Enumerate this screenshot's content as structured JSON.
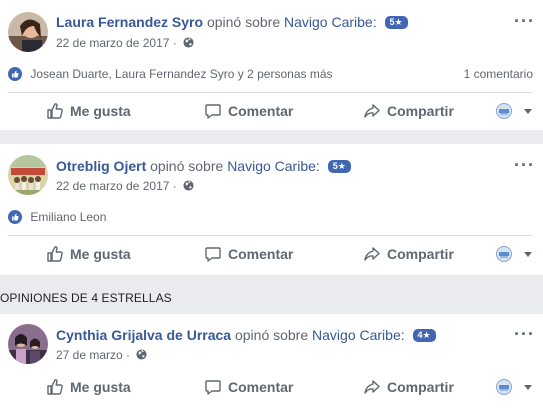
{
  "posts": [
    {
      "author": "Laura Fernandez Syro",
      "verb": "opinó sobre",
      "place": "Navigo Caribe:",
      "rating_badge": "5★",
      "date": "22 de marzo de 2017 ·",
      "reactions_text": "Josean Duarte, Laura Fernandez Syro y 2 personas más",
      "comments_count": "1 comentario",
      "more": "···"
    },
    {
      "author": "Otreblig Ojert",
      "verb": "opinó sobre",
      "place": "Navigo Caribe:",
      "rating_badge": "5★",
      "date": "22 de marzo de 2017 ·",
      "reactions_text": "Emiliano Leon",
      "more": "···"
    },
    {
      "author": "Cynthia Grijalva de Urraca",
      "verb": "opinó sobre",
      "place": "Navigo Caribe:",
      "rating_badge": "4★",
      "date": "27 de marzo ·",
      "more": "···"
    }
  ],
  "section_header": "OPINIONES DE 4 ESTRELLAS",
  "actions": {
    "like": "Me gusta",
    "comment": "Comentar",
    "share": "Compartir"
  },
  "colors": {
    "link": "#385898",
    "badge": "#4267b2",
    "muted": "#616770",
    "background": "#e9ebee"
  }
}
